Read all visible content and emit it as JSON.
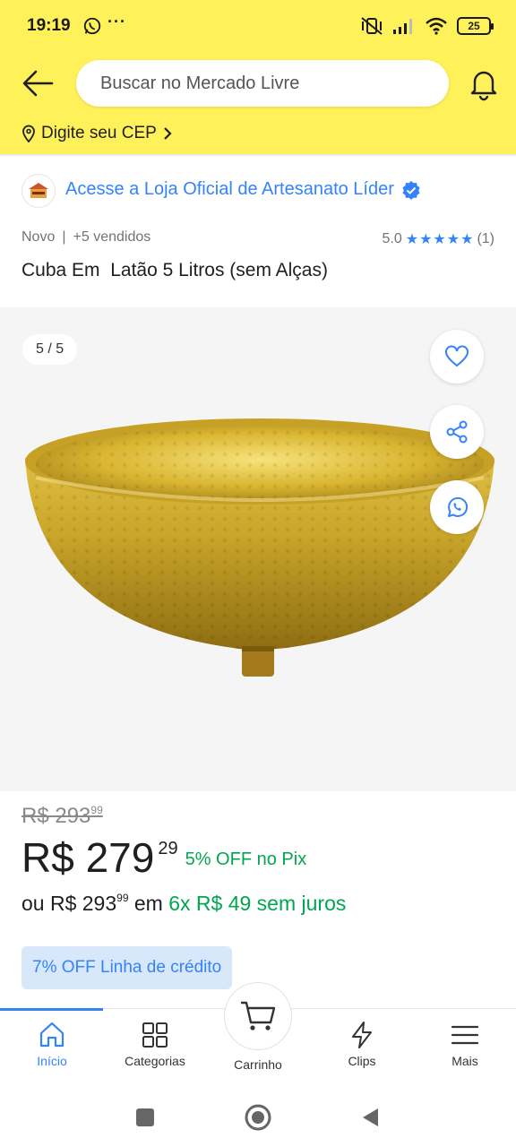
{
  "status_bar": {
    "time": "19:19",
    "dots": "···",
    "battery": "25"
  },
  "header": {
    "search_placeholder": "Buscar no Mercado Livre",
    "cep_label": "Digite seu CEP"
  },
  "store": {
    "link_text": "Acesse a Loja Oficial de Artesanato Líder"
  },
  "product": {
    "condition": "Novo",
    "separator": "|",
    "sold": "+5 vendidos",
    "rating_value": "5.0",
    "rating_stars": 5,
    "rating_count": "(1)",
    "title": "Cuba Em  Latão 5 Litros (sem Alças)"
  },
  "gallery": {
    "counter": "5 / 5"
  },
  "price": {
    "old_main": "R$ 293",
    "old_cents": "99",
    "new_main": "R$ 279",
    "new_cents": "29",
    "pix_discount": "5% OFF no Pix",
    "installment_prefix": "ou R$ 293",
    "installment_cents": "99",
    "installment_em": "em",
    "installment_offer": "6x R$ 49 sem juros",
    "credit_badge": "7% OFF Linha de crédito"
  },
  "bottom_nav": {
    "items": [
      {
        "label": "Início"
      },
      {
        "label": "Categorias"
      },
      {
        "label": "Carrinho"
      },
      {
        "label": "Clips"
      },
      {
        "label": "Mais"
      }
    ]
  },
  "colors": {
    "header_yellow": "#fff159",
    "link_blue": "#3483fa",
    "green": "#00a650"
  }
}
